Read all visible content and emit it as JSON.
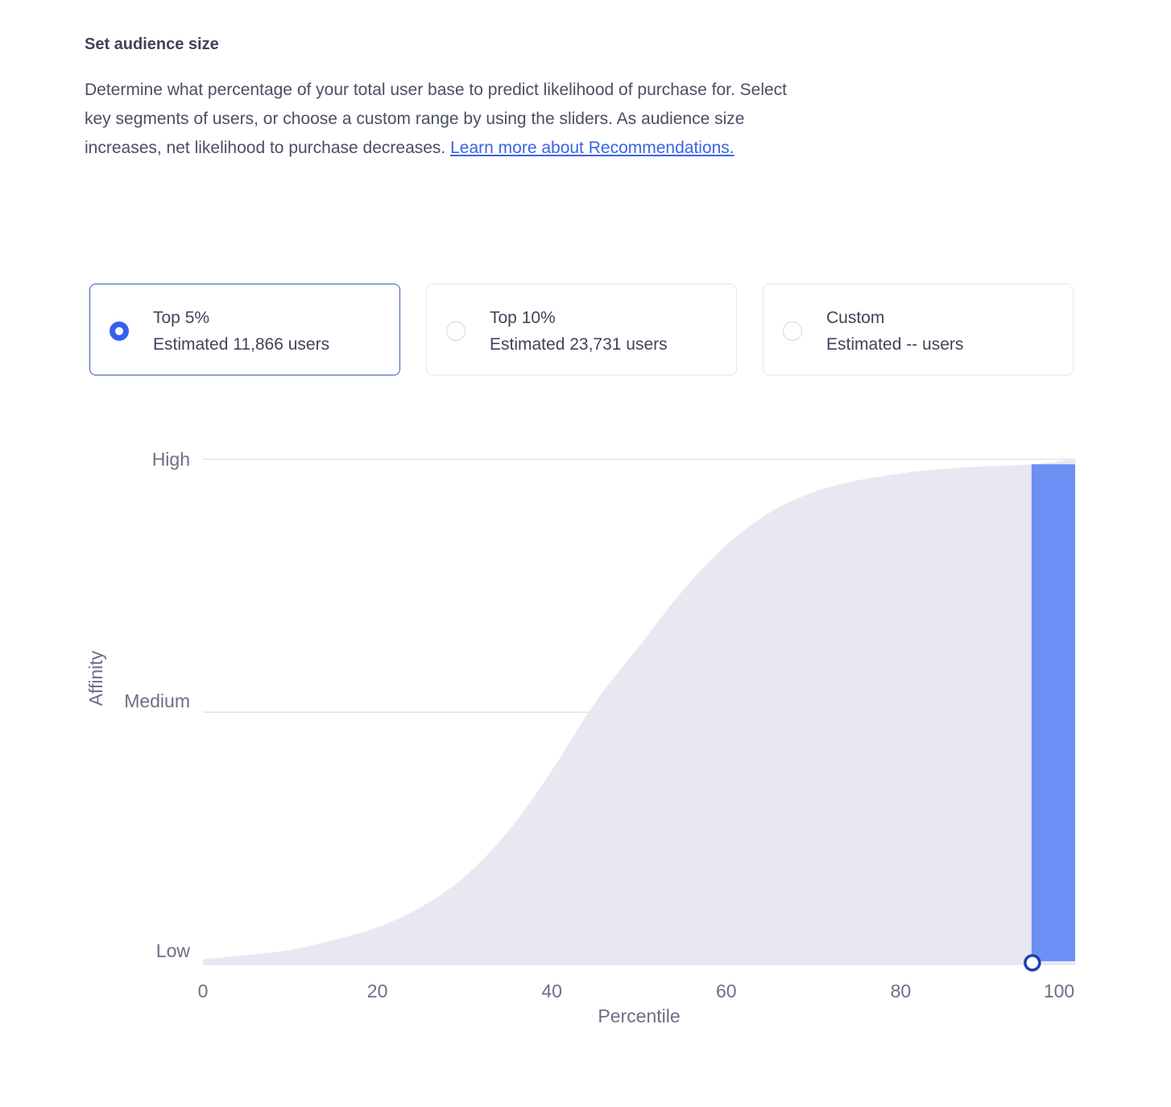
{
  "section": {
    "title": "Set audience size",
    "description": "Determine what percentage of your total user base to predict likelihood of purchase for. Select key segments of users, or choose a custom range by using the sliders. As audience size increases, net likelihood to purchase decreases. ",
    "link_text": "Learn more about Recommendations."
  },
  "options": [
    {
      "title": "Top 5%",
      "subtitle": "Estimated 11,866 users",
      "selected": true
    },
    {
      "title": "Top 10%",
      "subtitle": "Estimated 23,731 users",
      "selected": false
    },
    {
      "title": "Custom",
      "subtitle": "Estimated -- users",
      "selected": false
    }
  ],
  "colors": {
    "accent": "#3561f0",
    "area_fill": "#e8e8f3",
    "selection_fill": "#6b8ff5",
    "handle_stroke": "#1f3fb0"
  },
  "chart_data": {
    "type": "area",
    "title": "",
    "xlabel": "Percentile",
    "ylabel": "Affinity",
    "xlim": [
      0,
      100
    ],
    "ylim": [
      0,
      1
    ],
    "x_ticks": [
      "0",
      "20",
      "40",
      "60",
      "80",
      "100"
    ],
    "y_ticks": [
      {
        "label": "Low",
        "value": 0
      },
      {
        "label": "Medium",
        "value": 0.5
      },
      {
        "label": "High",
        "value": 1
      }
    ],
    "x": [
      0,
      5,
      10,
      15,
      20,
      25,
      30,
      35,
      40,
      45,
      50,
      55,
      60,
      65,
      70,
      75,
      80,
      85,
      90,
      95,
      100
    ],
    "y": [
      0.012,
      0.02,
      0.03,
      0.05,
      0.075,
      0.115,
      0.175,
      0.265,
      0.385,
      0.52,
      0.63,
      0.74,
      0.83,
      0.895,
      0.935,
      0.958,
      0.972,
      0.981,
      0.986,
      0.99,
      1.0
    ],
    "selection": {
      "from": 95,
      "to": 100
    },
    "grid": "horizontal"
  }
}
